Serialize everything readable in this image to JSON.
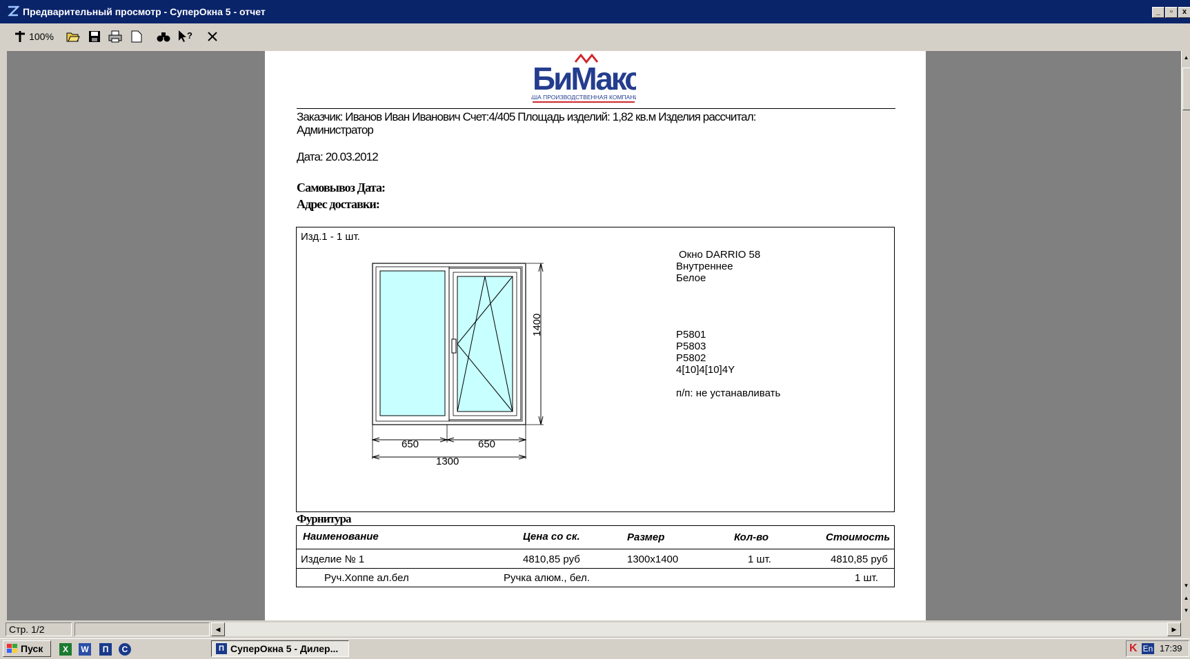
{
  "window": {
    "title": "Предварительный просмотр - СуперОкна 5 - отчет",
    "minimize": "_",
    "restore": "▫",
    "close": "x"
  },
  "toolbar": {
    "zoom_label": "100%"
  },
  "report": {
    "logo_text": "БиМакс",
    "logo_tagline": "ВАША ПРОИЗВОДСТВЕННАЯ КОМПАНИЯ",
    "customer_line": "Заказчик:   Иванов Иван Иванович Счет:4/405   Площадь изделий: 1,82 кв.м   Изделия рассчитал:",
    "customer_line2": "Администратор",
    "date_line": "Дата: 20.03.2012",
    "pickup_label": "Самовывоз Дата:",
    "delivery_label": "Адрес доставки:",
    "item_header": "Изд.1 - 1 шт.",
    "window_props": [
      "Окно DARRIO 58",
      "Внутреннее",
      "Белое"
    ],
    "profiles": [
      "P5801",
      "P5803",
      "P5802",
      "4[10]4[10]4Y"
    ],
    "note": "п/п: не устанавливать",
    "dims": {
      "left_width": "650",
      "right_width": "650",
      "total_width": "1300",
      "height": "1400"
    },
    "hardware_title": "Фурнитура",
    "table": {
      "headers": [
        "Наименование",
        "Цена со ск.",
        "Размер",
        "Кол-во",
        "Стоимость"
      ],
      "row1": [
        "Изделие № 1",
        "4810,85 руб",
        "1300x1400",
        "1 шт.",
        "4810,85 руб"
      ],
      "row2": [
        "Руч.Хоппе ал.бел",
        "Ручка алюм., бел.",
        "1 шт."
      ]
    }
  },
  "status": {
    "page": "Стр. 1/2"
  },
  "taskbar": {
    "start": "Пуск",
    "task": "СуперОкна 5 - Дилер...",
    "lang": "En",
    "clock": "17:39"
  }
}
